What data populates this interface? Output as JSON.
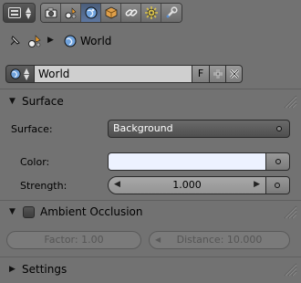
{
  "toolbar": {
    "context_tabs": [
      {
        "name": "render-tab",
        "icon": "camera-icon",
        "active": false
      },
      {
        "name": "scene-tab",
        "icon": "scene-icon",
        "active": false
      },
      {
        "name": "world-tab",
        "icon": "world-icon",
        "active": true
      },
      {
        "name": "object-tab",
        "icon": "cube-icon",
        "active": false
      },
      {
        "name": "constraints-tab",
        "icon": "chain-icon",
        "active": false
      },
      {
        "name": "particles-tab",
        "icon": "gear-icon",
        "active": false
      },
      {
        "name": "physics-tab",
        "icon": "wrench-icon",
        "active": false
      }
    ]
  },
  "breadcrumb": {
    "world_label": "World"
  },
  "datablock": {
    "name": "World",
    "fake_user_label": "F"
  },
  "surface_panel": {
    "title": "Surface",
    "surface_label": "Surface:",
    "surface_value": "Background",
    "color_label": "Color:",
    "color_value": "#edf2ff",
    "strength_label": "Strength:",
    "strength_value": "1.000"
  },
  "ao_panel": {
    "title": "Ambient Occlusion",
    "enabled": false,
    "factor_text": "Factor: 1.00",
    "distance_text": "Distance: 10.000"
  },
  "settings_panel": {
    "title": "Settings"
  }
}
